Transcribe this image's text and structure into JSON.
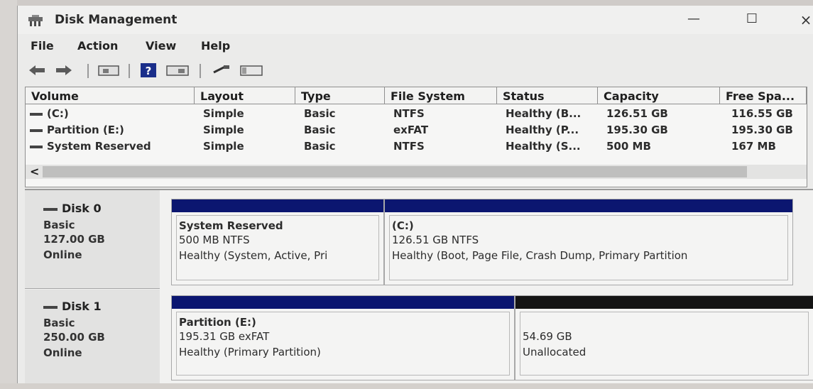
{
  "window": {
    "title": "Disk Management",
    "controls": {
      "minimize": "—",
      "maximize": "☐",
      "close": "×"
    }
  },
  "menu": {
    "items": [
      "File",
      "Action",
      "View",
      "Help"
    ]
  },
  "toolbar": {
    "icons": [
      "back-arrow-icon",
      "forward-arrow-icon",
      "disk-list-icon",
      "help-icon",
      "properties-icon",
      "rescan-icon",
      "console-icon"
    ]
  },
  "volume_list": {
    "headers": [
      "Volume",
      "Layout",
      "Type",
      "File System",
      "Status",
      "Capacity",
      "Free Spa..."
    ],
    "rows": [
      {
        "volume": "(C:)",
        "layout": "Simple",
        "type": "Basic",
        "fs": "NTFS",
        "status": "Healthy (B...",
        "capacity": "126.51 GB",
        "free": "116.55 GB"
      },
      {
        "volume": "Partition (E:)",
        "layout": "Simple",
        "type": "Basic",
        "fs": "exFAT",
        "status": "Healthy (P...",
        "capacity": "195.30 GB",
        "free": "195.30 GB"
      },
      {
        "volume": "System Reserved",
        "layout": "Simple",
        "type": "Basic",
        "fs": "NTFS",
        "status": "Healthy (S...",
        "capacity": "500 MB",
        "free": "167 MB"
      }
    ],
    "scroll_left": "<"
  },
  "disks": [
    {
      "name": "Disk 0",
      "kind": "Basic",
      "size": "127.00 GB",
      "state": "Online",
      "partitions": [
        {
          "name": "System Reserved",
          "detail": "500 MB NTFS",
          "status": "Healthy (System, Active, Pri",
          "bar_color": "#0b1670"
        },
        {
          "name": "(C:)",
          "detail": "126.51 GB NTFS",
          "status": "Healthy (Boot, Page File, Crash Dump, Primary Partition",
          "bar_color": "#0b1670"
        }
      ]
    },
    {
      "name": "Disk 1",
      "kind": "Basic",
      "size": "250.00 GB",
      "state": "Online",
      "partitions": [
        {
          "name": "Partition (E:)",
          "detail": "195.31 GB exFAT",
          "status": "Healthy (Primary Partition)",
          "bar_color": "#0b1670"
        },
        {
          "name": "",
          "detail": "54.69 GB",
          "status": "Unallocated",
          "bar_color": "#141414"
        }
      ]
    }
  ]
}
